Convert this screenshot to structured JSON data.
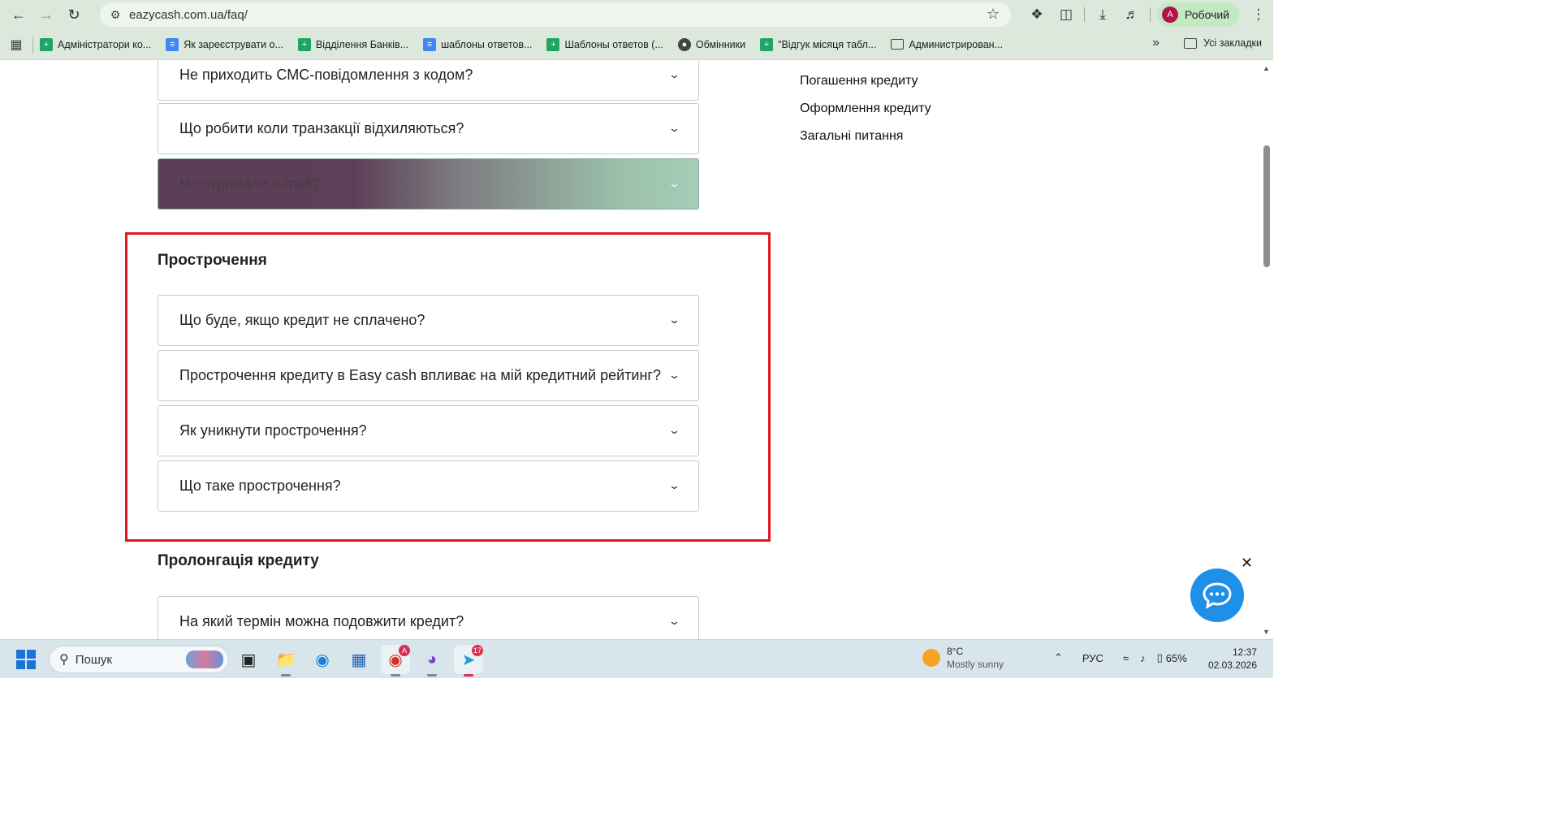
{
  "browser": {
    "url": "eazycash.com.ua/faq/",
    "profile_initial": "A",
    "profile_label": "Робочий"
  },
  "bookmarks": [
    {
      "label": "Адміністратори ко...",
      "icon": "sheets-icon"
    },
    {
      "label": "Як зареєструвати о...",
      "icon": "docs-icon"
    },
    {
      "label": "Відділення Банків...",
      "icon": "sheets-icon"
    },
    {
      "label": "шаблоны ответов...",
      "icon": "docs-icon"
    },
    {
      "label": "Шаблоны ответов (...",
      "icon": "sheets-icon"
    },
    {
      "label": "Обмінники",
      "icon": "globe-icon"
    },
    {
      "label": "\"Відгук місяця табл...",
      "icon": "sheets-icon"
    },
    {
      "label": "Администрирован...",
      "icon": "folder-icon"
    }
  ],
  "all_bookmarks_label": "Усі закладки",
  "faq": {
    "top_questions": [
      "Не приходить СМС-повідомлення з кодом?",
      "Що робити коли транзакції відхиляються?",
      "Не отримали e-mail?"
    ],
    "overdue": {
      "title": "Прострочення",
      "questions": [
        "Що буде, якщо кредит не сплачено?",
        "Прострочення кредиту в Easy cash впливає на мій кредитний рейтинг?",
        "Як уникнути прострочення?",
        "Що таке прострочення?"
      ]
    },
    "prolongation": {
      "title": "Пролонгація кредиту",
      "questions": [
        "На який термін можна подовжити кредит?"
      ]
    }
  },
  "side_nav": [
    "Погашення кредиту",
    "Оформлення кредиту",
    "Загальні питання"
  ],
  "taskbar": {
    "search_placeholder": "Пошук",
    "chrome_badge": "A",
    "telegram_badge": "17",
    "weather_temp": "8°C",
    "weather_condition": "Mostly sunny",
    "language": "РУС",
    "battery": "65%",
    "time": "12:37",
    "date": "02.03.2026"
  },
  "colors": {
    "highlight_border": "#e0191e",
    "chat_button": "#1e90e8",
    "browser_chrome": "#dbe8db"
  }
}
